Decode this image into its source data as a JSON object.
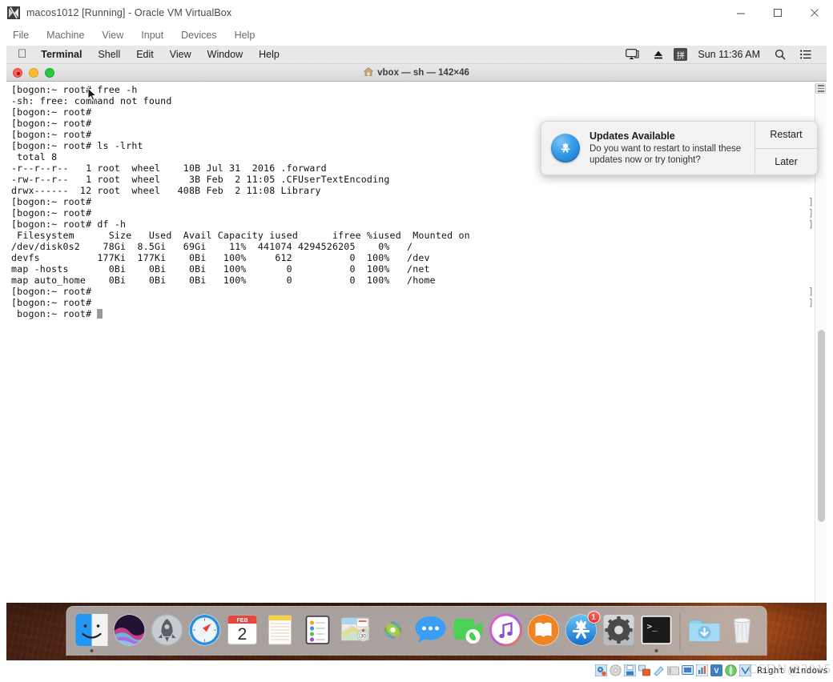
{
  "vbox": {
    "title": "macos1012 [Running] - Oracle VM VirtualBox",
    "app_icon": "virtualbox-icon",
    "menu": [
      {
        "label": "File"
      },
      {
        "label": "Machine"
      },
      {
        "label": "View"
      },
      {
        "label": "Input"
      },
      {
        "label": "Devices"
      },
      {
        "label": "Help"
      }
    ],
    "window_controls": [
      {
        "name": "minimize-button",
        "icon": "minimize-icon"
      },
      {
        "name": "maximize-button",
        "icon": "maximize-icon"
      },
      {
        "name": "close-button",
        "icon": "close-icon"
      }
    ],
    "statusbar": {
      "host_key": "Right Windows",
      "watermark": "CSDN@2015",
      "icons": [
        "hard-disk-icon",
        "optical-disk-icon",
        "floppy-icon",
        "network-icon",
        "usb-icon",
        "shared-folder-icon",
        "display-icon",
        "recording-icon",
        "video-capture-icon",
        "mouse-integration-icon",
        "keyboard-icon"
      ]
    }
  },
  "macos": {
    "menubar": {
      "apple_logo": "apple-icon",
      "app_name": "Terminal",
      "items": [
        {
          "label": "Shell"
        },
        {
          "label": "Edit"
        },
        {
          "label": "View"
        },
        {
          "label": "Window"
        },
        {
          "label": "Help"
        }
      ],
      "status": {
        "airplay_icon": "airplay-icon",
        "eject_icon": "eject-icon",
        "input_source": "拼",
        "clock": "Sun 11:36 AM",
        "search_icon": "search-icon",
        "notification_center_icon": "list-icon"
      }
    },
    "terminal": {
      "title": "vbox — sh — 142×46",
      "home_icon": "home-icon",
      "traffic_lights": [
        "close-button",
        "minimize-button",
        "zoom-button"
      ],
      "lines": [
        "[bogon:~ root# free -h",
        "-sh: free: command not found",
        "[bogon:~ root#",
        "[bogon:~ root#",
        "[bogon:~ root#",
        "[bogon:~ root# ls -lrht",
        " total 8",
        "-r--r--r--   1 root  wheel    10B Jul 31  2016 .forward",
        "-rw-r--r--   1 root  wheel     3B Feb  2 11:05 .CFUserTextEncoding",
        "drwx------  12 root  wheel   408B Feb  2 11:08 Library",
        "[bogon:~ root#",
        "[bogon:~ root#",
        "[bogon:~ root# df -h",
        " Filesystem      Size   Used  Avail Capacity iused      ifree %iused  Mounted on",
        "/dev/disk0s2    78Gi  8.5Gi   69Gi    11%  441074 4294526205    0%   /",
        "devfs          177Ki  177Ki    0Bi   100%     612          0  100%   /dev",
        "map -hosts       0Bi    0Bi    0Bi   100%       0          0  100%   /net",
        "map auto_home    0Bi    0Bi    0Bi   100%       0          0  100%   /home",
        "[bogon:~ root#",
        "[bogon:~ root#",
        " bogon:~ root# "
      ],
      "wrap_bracket": "]",
      "wrap_bracket_rows": [
        4,
        5,
        10,
        11,
        12,
        18,
        19
      ]
    },
    "notification": {
      "icon": "app-store-icon",
      "title": "Updates Available",
      "body": "Do you want to restart to install these updates now or try tonight?",
      "buttons": [
        {
          "label": "Restart"
        },
        {
          "label": "Later"
        }
      ]
    },
    "dock": {
      "items": [
        {
          "name": "finder",
          "icon": "finder-icon",
          "running": true
        },
        {
          "name": "siri",
          "icon": "siri-icon",
          "running": false
        },
        {
          "name": "launchpad",
          "icon": "launchpad-icon",
          "running": false
        },
        {
          "name": "safari",
          "icon": "safari-icon",
          "running": false
        },
        {
          "name": "calendar",
          "icon": "calendar-icon",
          "running": false,
          "month": "FEB",
          "day": "2"
        },
        {
          "name": "notes",
          "icon": "notes-icon",
          "running": false
        },
        {
          "name": "reminders",
          "icon": "reminders-icon",
          "running": false
        },
        {
          "name": "maps",
          "icon": "maps-icon",
          "running": false
        },
        {
          "name": "photos",
          "icon": "photos-icon",
          "running": false
        },
        {
          "name": "messages",
          "icon": "messages-icon",
          "running": false
        },
        {
          "name": "facetime",
          "icon": "facetime-icon",
          "running": false
        },
        {
          "name": "itunes",
          "icon": "itunes-icon",
          "running": false
        },
        {
          "name": "ibooks",
          "icon": "ibooks-icon",
          "running": false
        },
        {
          "name": "app-store",
          "icon": "app-store-icon",
          "running": false,
          "badge": "1"
        },
        {
          "name": "system-preferences",
          "icon": "gear-icon",
          "running": false
        },
        {
          "name": "terminal",
          "icon": "terminal-icon",
          "running": true
        }
      ],
      "right_items": [
        {
          "name": "downloads-folder",
          "icon": "downloads-folder-icon"
        },
        {
          "name": "trash",
          "icon": "trash-icon"
        }
      ]
    }
  }
}
